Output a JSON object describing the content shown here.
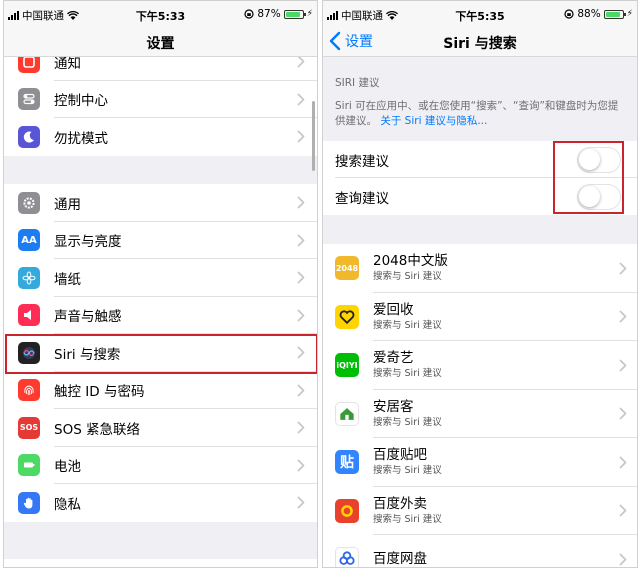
{
  "left": {
    "status": {
      "carrier": "中国联通",
      "time": "下午5:33",
      "battery": "87%",
      "battery_level": 0.87
    },
    "nav": {
      "title": "设置"
    },
    "group1": [
      {
        "label": "通知",
        "icon": "notification-icon",
        "color": "#ff3b30"
      },
      {
        "label": "控制中心",
        "icon": "control-center-icon",
        "color": "#8e8e93"
      },
      {
        "label": "勿扰模式",
        "icon": "moon-icon",
        "color": "#5856d6"
      }
    ],
    "group2": [
      {
        "label": "通用",
        "icon": "gear-icon",
        "color": "#8e8e93"
      },
      {
        "label": "显示与亮度",
        "icon": "text-size-icon",
        "color": "#1e7cf2",
        "glyph": "AA"
      },
      {
        "label": "墙纸",
        "icon": "wallpaper-icon",
        "color": "#34aadc"
      },
      {
        "label": "声音与触感",
        "icon": "speaker-icon",
        "color": "#ff2d55"
      },
      {
        "label": "Siri 与搜索",
        "icon": "siri-icon",
        "color": "#222222"
      },
      {
        "label": "触控 ID 与密码",
        "icon": "fingerprint-icon",
        "color": "#ff3b30"
      },
      {
        "label": "SOS 紧急联络",
        "icon": "sos-icon",
        "color": "#e53935",
        "glyph": "SOS"
      },
      {
        "label": "电池",
        "icon": "battery-icon",
        "color": "#4cd964"
      },
      {
        "label": "隐私",
        "icon": "hand-icon",
        "color": "#3478f6"
      }
    ]
  },
  "right": {
    "status": {
      "carrier": "中国联通",
      "time": "下午5:35",
      "battery": "88%",
      "battery_level": 0.88
    },
    "nav": {
      "title": "Siri 与搜索",
      "back_label": "设置"
    },
    "section": {
      "header": "SIRI 建议",
      "description": "Siri 可在应用中、或在您使用“搜索”、“查询”和键盘时为您提供建议。",
      "link": "关于 Siri 建议与隐私..."
    },
    "toggles": [
      {
        "label": "搜索建议",
        "on": false
      },
      {
        "label": "查询建议",
        "on": false
      }
    ],
    "apps": [
      {
        "name": "2048中文版",
        "sub": "搜索与 Siri 建议",
        "icon": "app-2048-icon",
        "color": "#f0b92b",
        "glyph": "2048",
        "fg": "#ffffff"
      },
      {
        "name": "爱回收",
        "sub": "搜索与 Siri 建议",
        "icon": "app-aihuishou-icon",
        "color": "#ffd400",
        "glyph": "",
        "fg": "#222222"
      },
      {
        "name": "爱奇艺",
        "sub": "搜索与 Siri 建议",
        "icon": "app-iqiyi-icon",
        "color": "#00be06",
        "glyph": "iQIYI",
        "fg": "#ffffff"
      },
      {
        "name": "安居客",
        "sub": "搜索与 Siri 建议",
        "icon": "app-anjuke-icon",
        "color": "#ffffff",
        "glyph": "",
        "fg": "#3a9a3a"
      },
      {
        "name": "百度贴吧",
        "sub": "搜索与 Siri 建议",
        "icon": "app-tieba-icon",
        "color": "#3385ff",
        "glyph": "贴",
        "fg": "#ffffff"
      },
      {
        "name": "百度外卖",
        "sub": "搜索与 Siri 建议",
        "icon": "app-baidu-waimai-icon",
        "color": "#e8412c",
        "glyph": "",
        "fg": "#ffffff"
      },
      {
        "name": "百度网盘",
        "sub": "",
        "icon": "app-baidu-netdisk-icon",
        "color": "#ffffff",
        "glyph": "",
        "fg": "#2f6ae6"
      }
    ]
  }
}
